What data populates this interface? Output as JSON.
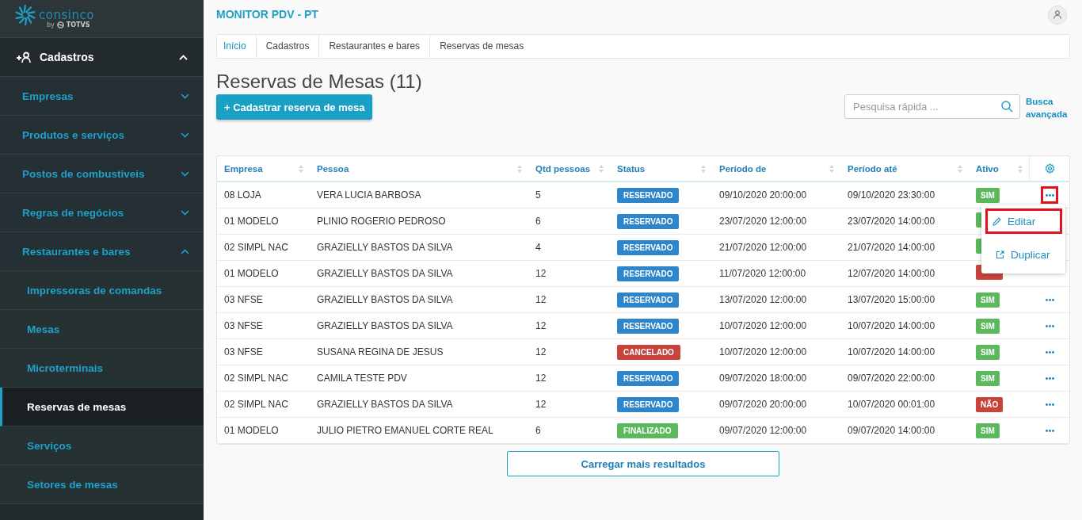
{
  "logo": {
    "name": "consinco",
    "byline": "by",
    "brand": "TOTVS"
  },
  "sidebar": {
    "items": [
      {
        "label": "Cadastros",
        "kind": "section",
        "expanded": true
      },
      {
        "label": "Empresas",
        "kind": "group",
        "expanded": false
      },
      {
        "label": "Produtos e serviços",
        "kind": "group",
        "expanded": false
      },
      {
        "label": "Postos de combustiveis",
        "kind": "group",
        "expanded": false
      },
      {
        "label": "Regras de negócios",
        "kind": "group",
        "expanded": false
      },
      {
        "label": "Restaurantes e bares",
        "kind": "group",
        "expanded": true
      },
      {
        "label": "Impressoras de comandas",
        "kind": "leaf",
        "selected": false
      },
      {
        "label": "Mesas",
        "kind": "leaf",
        "selected": false
      },
      {
        "label": "Microterminais",
        "kind": "leaf",
        "selected": false
      },
      {
        "label": "Reservas de mesas",
        "kind": "leaf",
        "selected": true
      },
      {
        "label": "Serviços",
        "kind": "leaf",
        "selected": false
      },
      {
        "label": "Setores de mesas",
        "kind": "leaf",
        "selected": false
      }
    ]
  },
  "header": {
    "title": "MONITOR PDV - PT"
  },
  "breadcrumb": [
    "Início",
    "Cadastros",
    "Restaurantes e bares",
    "Reservas de mesas"
  ],
  "page": {
    "title": "Reservas de Mesas (11)",
    "add_button": "+ Cadastrar reserva de mesa",
    "search": {
      "placeholder": "Pesquisa rápida ..."
    },
    "advanced_search": "Busca avançada"
  },
  "table": {
    "columns": [
      "Empresa",
      "Pessoa",
      "Qtd pessoas",
      "Status",
      "Período de",
      "Período até",
      "Ativo"
    ],
    "rows": [
      {
        "empresa": "08 LOJA",
        "pessoa": "VERA LUCIA BARBOSA",
        "qtd": "5",
        "status": {
          "label": "RESERVADO",
          "kind": "reservado"
        },
        "de": "09/10/2020 20:00:00",
        "ate": "09/10/2020 23:30:00",
        "ativo": {
          "label": "SIM",
          "kind": "sim"
        },
        "actions": true,
        "highlighted": true
      },
      {
        "empresa": "01 MODELO",
        "pessoa": "PLINIO ROGERIO PEDROSO",
        "qtd": "6",
        "status": {
          "label": "RESERVADO",
          "kind": "reservado"
        },
        "de": "23/07/2020 12:00:00",
        "ate": "23/07/2020 14:00:00",
        "ativo": {
          "kind": "sim"
        },
        "actions": false
      },
      {
        "empresa": "02 SIMPL NAC",
        "pessoa": "GRAZIELLY BASTOS DA SILVA",
        "qtd": "4",
        "status": {
          "label": "RESERVADO",
          "kind": "reservado"
        },
        "de": "21/07/2020 12:00:00",
        "ate": "21/07/2020 14:00:00",
        "ativo": {
          "kind": "sim"
        },
        "actions": false
      },
      {
        "empresa": "01 MODELO",
        "pessoa": "GRAZIELLY BASTOS DA SILVA",
        "qtd": "12",
        "status": {
          "label": "RESERVADO",
          "kind": "reservado"
        },
        "de": "11/07/2020 12:00:00",
        "ate": "12/07/2020 14:00:00",
        "ativo": {
          "kind": "nao"
        },
        "actions": false
      },
      {
        "empresa": "03 NFSE",
        "pessoa": "GRAZIELLY BASTOS DA SILVA",
        "qtd": "12",
        "status": {
          "label": "RESERVADO",
          "kind": "reservado"
        },
        "de": "13/07/2020 12:00:00",
        "ate": "13/07/2020 15:00:00",
        "ativo": {
          "label": "SIM",
          "kind": "sim"
        },
        "actions": true,
        "highlighted": false
      },
      {
        "empresa": "03 NFSE",
        "pessoa": "GRAZIELLY BASTOS DA SILVA",
        "qtd": "12",
        "status": {
          "label": "RESERVADO",
          "kind": "reservado"
        },
        "de": "10/07/2020 12:00:00",
        "ate": "10/07/2020 14:00:00",
        "ativo": {
          "label": "SIM",
          "kind": "sim"
        },
        "actions": true,
        "highlighted": false
      },
      {
        "empresa": "03 NFSE",
        "pessoa": "SUSANA REGINA DE JESUS",
        "qtd": "12",
        "status": {
          "label": "CANCELADO",
          "kind": "cancelado"
        },
        "de": "10/07/2020 12:00:00",
        "ate": "10/07/2020 14:00:00",
        "ativo": {
          "label": "SIM",
          "kind": "sim"
        },
        "actions": true,
        "highlighted": false
      },
      {
        "empresa": "02 SIMPL NAC",
        "pessoa": "CAMILA TESTE PDV",
        "qtd": "12",
        "status": {
          "label": "RESERVADO",
          "kind": "reservado"
        },
        "de": "09/07/2020 18:00:00",
        "ate": "09/07/2020 22:00:00",
        "ativo": {
          "label": "SIM",
          "kind": "sim"
        },
        "actions": true,
        "highlighted": false
      },
      {
        "empresa": "02 SIMPL NAC",
        "pessoa": "GRAZIELLY BASTOS DA SILVA",
        "qtd": "12",
        "status": {
          "label": "RESERVADO",
          "kind": "reservado"
        },
        "de": "09/07/2020 20:00:00",
        "ate": "10/07/2020 00:01:00",
        "ativo": {
          "label": "NÃO",
          "kind": "nao"
        },
        "actions": true,
        "highlighted": false
      },
      {
        "empresa": "01 MODELO",
        "pessoa": "JULIO PIETRO EMANUEL CORTE REAL",
        "qtd": "6",
        "status": {
          "label": "FINALIZADO",
          "kind": "finalizado"
        },
        "de": "09/07/2020 12:00:00",
        "ate": "09/07/2020 14:00:00",
        "ativo": {
          "label": "SIM",
          "kind": "sim"
        },
        "actions": true,
        "highlighted": false
      }
    ]
  },
  "action_menu": {
    "items": [
      {
        "label": "Editar",
        "kind": "edit",
        "highlighted": true
      },
      {
        "label": "Duplicar",
        "kind": "duplicate",
        "highlighted": false
      }
    ]
  },
  "load_more": "Carregar mais resultados"
}
